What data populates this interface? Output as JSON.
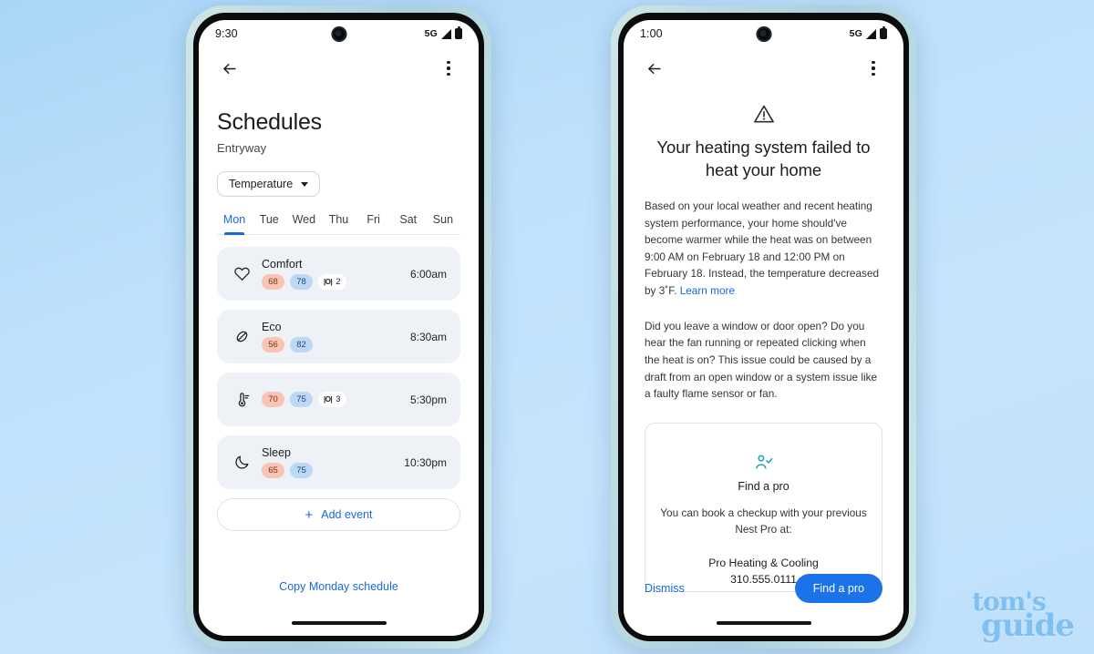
{
  "background": {
    "accent": "#1769e0",
    "cta": "#1a73e8",
    "page_bg_top": "#a9d6f7",
    "page_bg_bottom": "#bfe0fb"
  },
  "watermark": {
    "line1": "tom's",
    "line2": "guide"
  },
  "phone_left": {
    "status_bar": {
      "time": "9:30",
      "network": "5G",
      "signal_icon": "signal-bars-icon",
      "battery_icon": "battery-full-icon"
    },
    "app_bar": {
      "back_icon": "back-arrow-icon",
      "menu_icon": "overflow-menu-icon"
    },
    "title": "Schedules",
    "subtitle": "Entryway",
    "filter": {
      "label": "Temperature",
      "caret_icon": "chevron-down-icon"
    },
    "day_tabs": [
      {
        "label": "Mon",
        "active": true
      },
      {
        "label": "Tue",
        "active": false
      },
      {
        "label": "Wed",
        "active": false
      },
      {
        "label": "Thu",
        "active": false
      },
      {
        "label": "Fri",
        "active": false
      },
      {
        "label": "Sat",
        "active": false
      },
      {
        "label": "Sun",
        "active": false
      }
    ],
    "schedule_rows": [
      {
        "icon": "heart-icon",
        "title": "Comfort",
        "heat": "68",
        "cool": "78",
        "sensor_count": "2",
        "time": "6:00am"
      },
      {
        "icon": "leaf-icon",
        "title": "Eco",
        "heat": "56",
        "cool": "82",
        "sensor_count": "",
        "time": "8:30am"
      },
      {
        "icon": "thermometer-icon",
        "title": "",
        "heat": "70",
        "cool": "75",
        "sensor_count": "3",
        "time": "5:30pm"
      },
      {
        "icon": "moon-icon",
        "title": "Sleep",
        "heat": "65",
        "cool": "75",
        "sensor_count": "",
        "time": "10:30pm"
      }
    ],
    "add_event": {
      "plus": "+",
      "label": "Add event"
    },
    "copy_schedule": "Copy Monday schedule"
  },
  "phone_right": {
    "status_bar": {
      "time": "1:00",
      "network": "5G",
      "signal_icon": "signal-bars-icon",
      "battery_icon": "battery-full-icon"
    },
    "app_bar": {
      "back_icon": "back-arrow-icon",
      "menu_icon": "overflow-menu-icon"
    },
    "warning_icon": "warning-triangle-icon",
    "alert_title": "Your heating system failed to heat your home",
    "paragraph_1": "Based on your local weather and recent heating system performance, your home should've become warmer while the heat was on between 9:00 AM on February 18 and 12:00 PM on February 18. Instead, the temperature decreased by 3˚F. ",
    "learn_more": "Learn more",
    "paragraph_2": "Did you leave a window or door open? Do you hear the fan running or repeated clicking when the heat is on? This issue could be caused by a draft from an open window or a system issue like a faulty flame sensor or fan.",
    "pro_card": {
      "icon": "person-check-icon",
      "title": "Find a pro",
      "description": "You can book a checkup with your previous Nest Pro at:",
      "company": "Pro Heating & Cooling",
      "phone": "310.555.0111"
    },
    "actions": {
      "dismiss": "Dismiss",
      "primary": "Find a pro"
    }
  }
}
